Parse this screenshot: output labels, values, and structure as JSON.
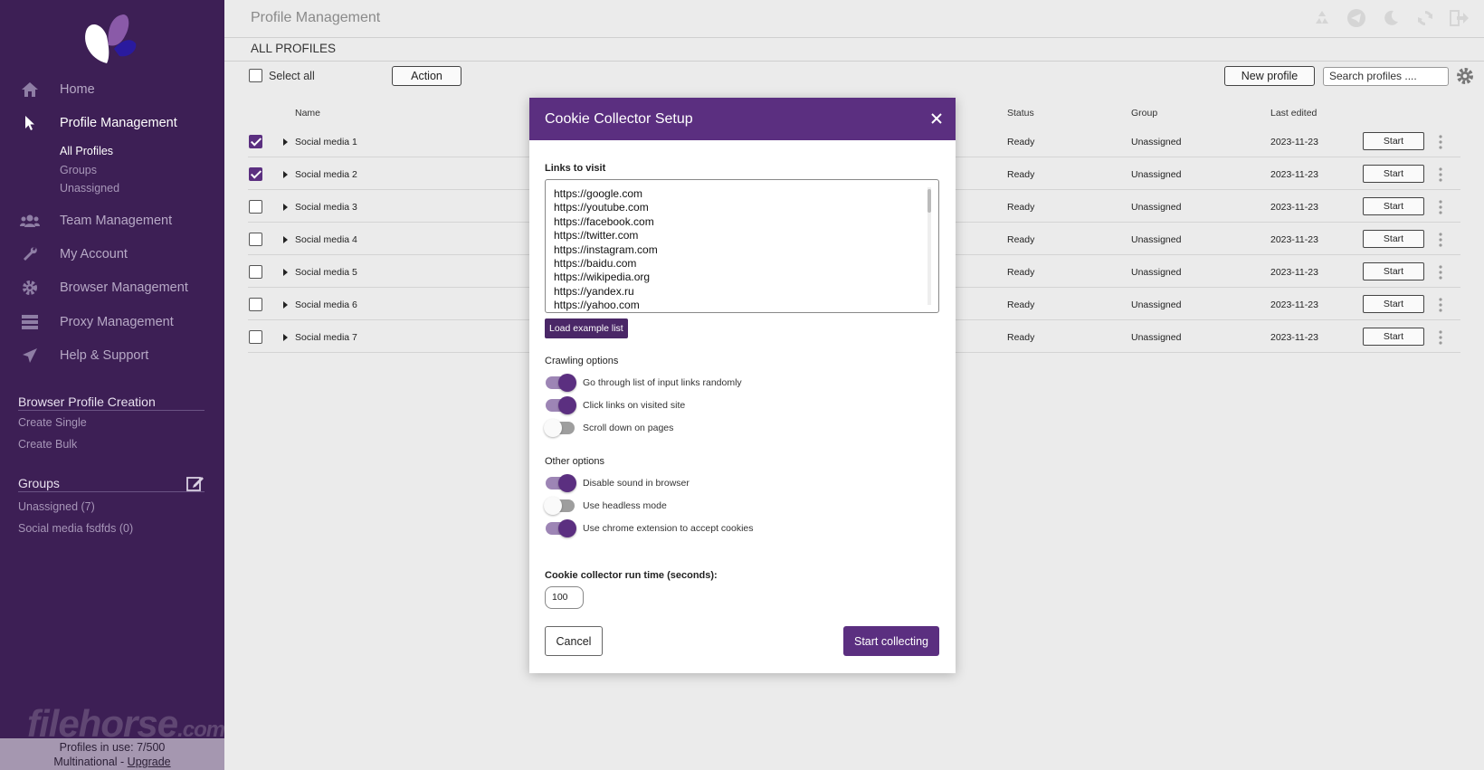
{
  "page": {
    "title": "Profile Management",
    "section": "ALL PROFILES"
  },
  "sidebar": {
    "nav": [
      {
        "label": "Home",
        "icon": "home-icon"
      },
      {
        "label": "Profile Management",
        "icon": "cursor-icon",
        "active": true
      },
      {
        "label": "Team Management",
        "icon": "users-icon"
      },
      {
        "label": "My Account",
        "icon": "wrench-icon"
      },
      {
        "label": "Browser Management",
        "icon": "gear-icon"
      },
      {
        "label": "Proxy Management",
        "icon": "server-icon"
      },
      {
        "label": "Help & Support",
        "icon": "paper-plane-icon"
      }
    ],
    "profile_sub": [
      "All Profiles",
      "Groups",
      "Unassigned"
    ],
    "creation_title": "Browser Profile Creation",
    "creation_links": [
      "Create Single",
      "Create Bulk"
    ],
    "groups_title": "Groups",
    "groups": [
      "Unassigned (7)",
      "Social media fsdfds (0)"
    ],
    "watermark": "filehorse",
    "watermark_suffix": ".com",
    "footer_usage": "Profiles in use:  7/500",
    "footer_plan": "Multinational - ",
    "footer_upgrade": "Upgrade"
  },
  "toolbar": {
    "select_all": "Select all",
    "action": "Action",
    "new_profile": "New profile",
    "search_placeholder": "Search profiles ...."
  },
  "table": {
    "headers": {
      "name": "Name",
      "status": "Status",
      "group": "Group",
      "last_edited": "Last edited"
    },
    "rows": [
      {
        "name": "Social media 1",
        "checked": true,
        "status": "Ready",
        "group": "Unassigned",
        "last_edited": "2023-11-23",
        "action": "Start"
      },
      {
        "name": "Social media 2",
        "checked": true,
        "status": "Ready",
        "group": "Unassigned",
        "last_edited": "2023-11-23",
        "action": "Start"
      },
      {
        "name": "Social media 3",
        "checked": false,
        "status": "Ready",
        "group": "Unassigned",
        "last_edited": "2023-11-23",
        "action": "Start"
      },
      {
        "name": "Social media 4",
        "checked": false,
        "status": "Ready",
        "group": "Unassigned",
        "last_edited": "2023-11-23",
        "action": "Start"
      },
      {
        "name": "Social media 5",
        "checked": false,
        "status": "Ready",
        "group": "Unassigned",
        "last_edited": "2023-11-23",
        "action": "Start"
      },
      {
        "name": "Social media 6",
        "checked": false,
        "status": "Ready",
        "group": "Unassigned",
        "last_edited": "2023-11-23",
        "action": "Start"
      },
      {
        "name": "Social media 7",
        "checked": false,
        "status": "Ready",
        "group": "Unassigned",
        "last_edited": "2023-11-23",
        "action": "Start"
      }
    ]
  },
  "modal": {
    "title": "Cookie Collector Setup",
    "links_label": "Links to visit",
    "links": [
      "https://google.com",
      "https://youtube.com",
      "https://facebook.com",
      "https://twitter.com",
      "https://instagram.com",
      "https://baidu.com",
      "https://wikipedia.org",
      "https://yandex.ru",
      "https://yahoo.com"
    ],
    "load_example": "Load example list",
    "crawling_title": "Crawling options",
    "crawling": [
      {
        "label": "Go through list of input links randomly",
        "on": true
      },
      {
        "label": "Click links on visited site",
        "on": true
      },
      {
        "label": "Scroll down on pages",
        "on": false
      }
    ],
    "other_title": "Other options",
    "other": [
      {
        "label": "Disable sound in browser",
        "on": true
      },
      {
        "label": "Use headless mode",
        "on": false
      },
      {
        "label": "Use chrome extension to accept cookies",
        "on": true
      }
    ],
    "runtime_label": "Cookie collector run time (seconds):",
    "runtime_value": "100",
    "cancel": "Cancel",
    "start": "Start collecting"
  },
  "colors": {
    "sidebar": "#3d1f55",
    "accent": "#5b2f80",
    "background": "#ebebeb"
  }
}
